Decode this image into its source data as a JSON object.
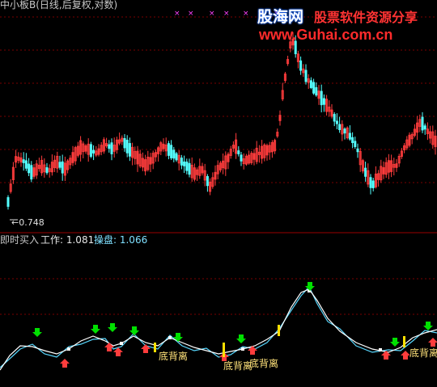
{
  "title": "中小板B(日线,后复权,对数)",
  "watermark": {
    "cn": "股海网",
    "slogan": "股票软件资源分享",
    "url": "www.Guhai.com.cn"
  },
  "price_panel": {
    "low_label": "←0.748"
  },
  "indicator_panel": {
    "name": "即时买入",
    "work_label": "工作: 1.081",
    "cao_label": "操盘: 1.066",
    "labels": [
      "底背离",
      "底背离",
      "底背离",
      "底背离"
    ]
  },
  "colors": {
    "up": "#ff3c3c",
    "down": "#54ffff",
    "grid": "#7a0000",
    "line_white": "#ffffff",
    "line_cyan": "#58d8ff",
    "buy_arrow": "#ff3c3c",
    "sell_arrow": "#00e000",
    "bar_yellow": "#ffe000",
    "marker_magenta": "#ff40ff"
  },
  "icons": {
    "sell": "green-down-arrow-icon",
    "buy": "red-up-arrow-icon",
    "marker": "magenta-x-icon"
  }
}
